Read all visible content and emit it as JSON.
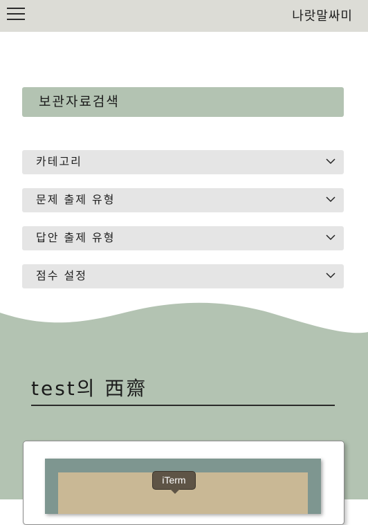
{
  "header": {
    "title": "나랏말싸미",
    "menu_icon": "hamburger-menu-icon"
  },
  "search": {
    "title": "보관자료검색",
    "dropdowns": [
      {
        "label": "카테고리"
      },
      {
        "label": "문제 출제 유형"
      },
      {
        "label": "답안 출제 유형"
      },
      {
        "label": "점수 설정"
      }
    ],
    "chevron_icon": "chevron-down-icon"
  },
  "study": {
    "title": "test의 西齋"
  },
  "tooltip": {
    "text": "iTerm"
  },
  "colors": {
    "topbar": "#dcdcd6",
    "accent_green": "#b3c3b2",
    "dropdown_bg": "#e5e5e5",
    "frame": "#7e9690",
    "paper": "#c9b895",
    "tooltip_bg": "#5e5446"
  }
}
